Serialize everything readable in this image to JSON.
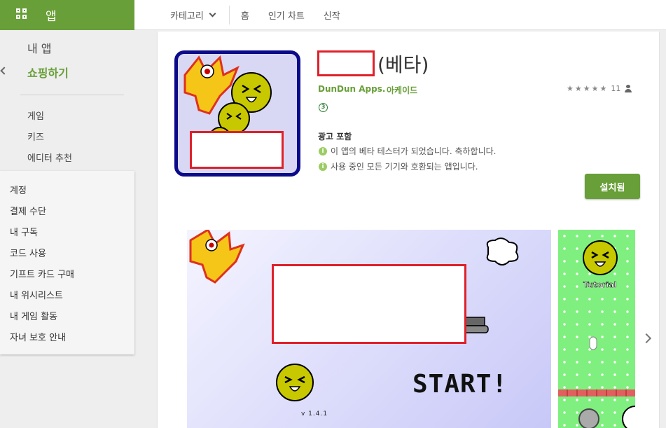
{
  "topbar": {
    "apps_label": "앱",
    "nav": {
      "category": "카테고리",
      "home": "홈",
      "top_charts": "인기 차트",
      "new": "신작"
    }
  },
  "sidebar": {
    "my_apps": "내 앱",
    "shop": "쇼핑하기",
    "items": [
      "게임",
      "키즈",
      "에디터 추천"
    ],
    "account_items": [
      "계정",
      "결제 수단",
      "내 구독",
      "코드 사용",
      "기프트 카드 구매",
      "내 위시리스트",
      "내 게임 활동",
      "자녀 보호 안내"
    ]
  },
  "app": {
    "title_suffix": "(베타)",
    "developer": "DunDun Apps.",
    "category": "아케이드",
    "rating_stars": 5,
    "rating_count": "11",
    "age_rating": "3",
    "contains_ads": "광고 포함",
    "info": [
      "이 앱의 베타 테스터가 되었습니다. 축하합니다.",
      "사용 중인 모든 기기와 호환되는 앱입니다."
    ],
    "install_label": "설치됨"
  },
  "screenshots": {
    "start_text": "START!",
    "version": "v 1.4.1",
    "tutorial": "Tutorial"
  },
  "colors": {
    "brand_green": "#689f38",
    "redaction": "#e0202a"
  },
  "icons": [
    "apps-grid-icon",
    "chevron-down-icon",
    "back-chevron-icon",
    "star-icon",
    "person-icon",
    "info-icon",
    "next-arrow-icon"
  ]
}
